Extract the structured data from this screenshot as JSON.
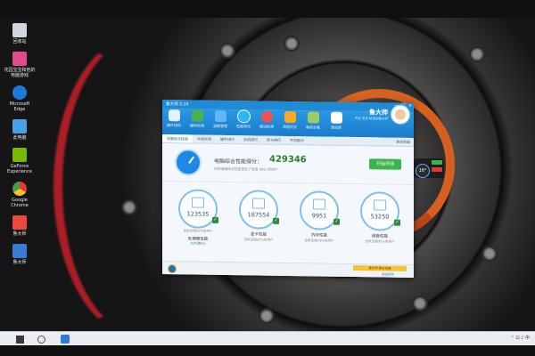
{
  "desktop": {
    "icons": [
      {
        "label": "回收站",
        "icon": "recycle-bin-icon",
        "color": "#cfd6de"
      },
      {
        "label": "花园宝宝和他的电脑游戏",
        "icon": "game-app-icon",
        "color": "#e04a8f"
      },
      {
        "label": "Microsoft Edge",
        "icon": "edge-icon",
        "color": "#1e7ad8"
      },
      {
        "label": "此电脑",
        "icon": "computer-icon",
        "color": "#4aa0e6"
      },
      {
        "label": "GeForce Experience",
        "icon": "geforce-icon",
        "color": "#76b900"
      },
      {
        "label": "Google Chrome",
        "icon": "chrome-icon",
        "color": "#f2b233"
      },
      {
        "label": "鲁大师",
        "icon": "ludashi-icon",
        "color": "#e94a3c"
      },
      {
        "label": "鲁大师",
        "icon": "ludashi-icon",
        "color": "#3a7bd5"
      }
    ]
  },
  "app": {
    "title": "鲁大师 5.20",
    "brand": {
      "name": "鲁大师",
      "slogan": "专业·安全·好用的鲁大师"
    },
    "window_controls": [
      "—",
      "□",
      "×"
    ],
    "toolbar": [
      {
        "label": "硬件体检",
        "color": "#ffffff"
      },
      {
        "label": "硬件检测",
        "color": "#4caf50"
      },
      {
        "label": "温度管理",
        "color": "#64b5f6"
      },
      {
        "label": "性能测试",
        "color": "#29b6f6",
        "active": true
      },
      {
        "label": "驱动检测",
        "color": "#ef5350"
      },
      {
        "label": "清理优化",
        "color": "#ffa726"
      },
      {
        "label": "装机必备",
        "color": "#9ccc65"
      },
      {
        "label": "游戏库",
        "color": "#ffffff"
      }
    ],
    "tabs": [
      {
        "label": "电脑综合性能",
        "selected": true
      },
      {
        "label": "手机评测"
      },
      {
        "label": "硬件排行"
      },
      {
        "label": "手机排行"
      },
      {
        "label": "显卡排行"
      },
      {
        "label": "手机跑分"
      }
    ],
    "tab_right": "游戏性能",
    "score": {
      "label": "电脑综合性能得分：",
      "value": "429346",
      "sub": "你的电脑综合性能击败了全国 98% 的用户",
      "button": "开始评测"
    },
    "categories": [
      {
        "value": "123535",
        "label": "处理器性能",
        "sub": "击败全国93%的用户",
        "rank": "(CPU跑分)"
      },
      {
        "value": "187554",
        "label": "显卡性能",
        "sub": "击败全国95%的用户"
      },
      {
        "value": "9951",
        "label": "内存性能",
        "sub": "击败全国76%的用户"
      },
      {
        "value": "53250",
        "label": "磁盘性能",
        "sub": "击败全国95%的用户"
      }
    ],
    "footer": {
      "bar_text": "鲁大师 跑分加速",
      "version": "开始评测"
    }
  },
  "widget": {
    "temp": "16°"
  },
  "taskbar": {
    "tray_text": "⌃ ⊡ ♪ 中"
  }
}
